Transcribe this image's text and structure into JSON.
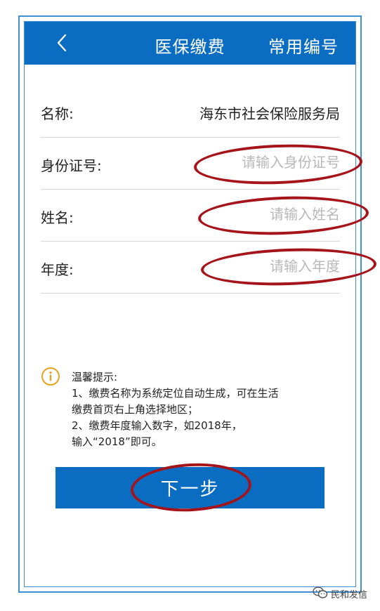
{
  "header": {
    "back_icon": "chevron-left-icon",
    "title": "医保缴费",
    "right_action": "常用编号"
  },
  "form": {
    "rows": [
      {
        "label": "名称:",
        "value": "海东市社会保险服务局"
      },
      {
        "label": "身份证号:",
        "placeholder": "请输入身份证号"
      },
      {
        "label": "姓名:",
        "placeholder": "请输入姓名"
      },
      {
        "label": "年度:",
        "placeholder": "请输入年度"
      }
    ]
  },
  "tip": {
    "icon": "info-circle-icon",
    "lines": [
      "温馨提示:",
      "1、缴费名称为系统定位自动生成，可在生活",
      "缴费首页右上角选择地区；",
      "2、缴费年度输入数字，如2018年，",
      "输入“2018”即可。"
    ]
  },
  "next_button": {
    "label": "下一步"
  },
  "watermark": {
    "icon": "wechat-icon",
    "text": "民和发信"
  },
  "colors": {
    "header_bg": "#0b6dc1",
    "button_bg": "#0b6dc1",
    "annotation": "#a5141a",
    "frame": "#3f8fd4",
    "tip_icon": "#e8a321",
    "placeholder": "#b8b8b8"
  }
}
